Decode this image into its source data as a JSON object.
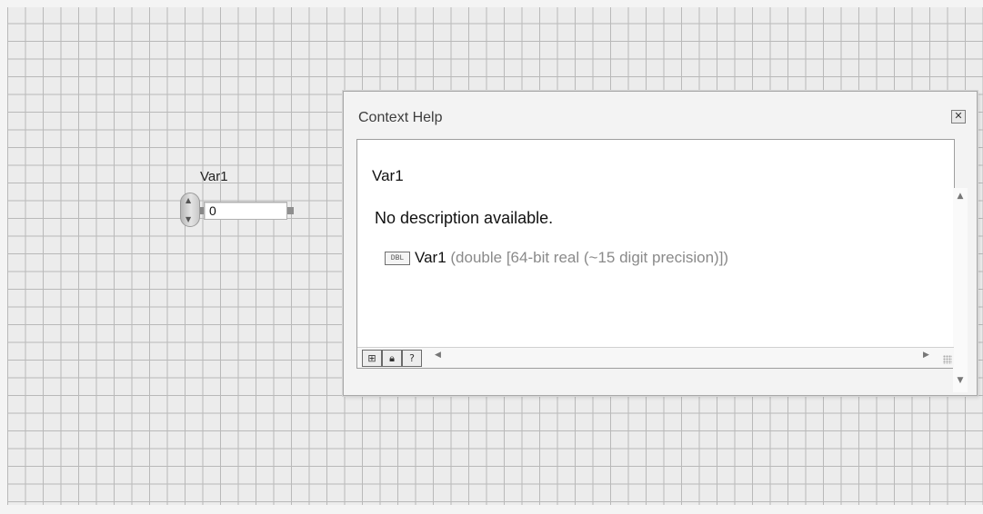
{
  "control": {
    "label": "Var1",
    "value": "0"
  },
  "context_help": {
    "title": "Context Help",
    "close_icon": "close-icon",
    "name": "Var1",
    "description": "No description available.",
    "terminal": {
      "icon_text": "DBL",
      "name": "Var1",
      "type": "(double [64-bit real (~15 digit precision)])"
    },
    "toolbar": {
      "buttons": [
        "show-optional-terminals-icon",
        "lock-icon",
        "detailed-help-icon"
      ]
    }
  },
  "colors": {
    "grid_background": "#ececec",
    "grid_lines": "#b9b9b9",
    "help_type_text": "#8a8a8a"
  }
}
